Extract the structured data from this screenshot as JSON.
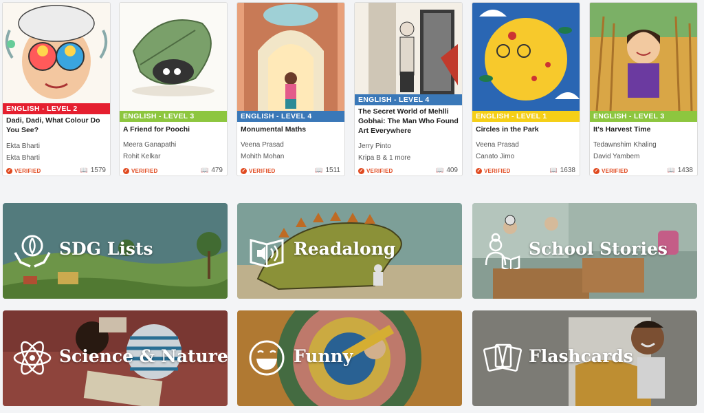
{
  "books": [
    {
      "level": "ENGLISH - LEVEL 2",
      "level_color": "#e51f2f",
      "title": "Dadi, Dadi, What Colour Do You See?",
      "authors": [
        "Ekta Bharti",
        "Ekta Bharti"
      ],
      "verified": "VERIFIED",
      "reads": "1579"
    },
    {
      "level": "ENGLISH - LEVEL 3",
      "level_color": "#8dc63f",
      "title": "A Friend for Poochi",
      "authors": [
        "Meera Ganapathi",
        "Rohit Kelkar"
      ],
      "verified": "VERIFIED",
      "reads": "479"
    },
    {
      "level": "ENGLISH - LEVEL 4",
      "level_color": "#3a78b8",
      "title": "Monumental Maths",
      "authors": [
        "Veena Prasad",
        "Mohith Mohan"
      ],
      "verified": "VERIFIED",
      "reads": "1511"
    },
    {
      "level": "ENGLISH - LEVEL 4",
      "level_color": "#3a78b8",
      "title": "The Secret World of Mehlli Gobhai: The Man Who Found Art Everywhere",
      "authors": [
        "Jerry Pinto",
        "Kripa B & 1 more"
      ],
      "verified": "VERIFIED",
      "reads": "409"
    },
    {
      "level": "ENGLISH - LEVEL 1",
      "level_color": "#f5cf17",
      "title": "Circles in the Park",
      "authors": [
        "Veena Prasad",
        "Canato Jimo"
      ],
      "verified": "VERIFIED",
      "reads": "1638"
    },
    {
      "level": "ENGLISH - LEVEL 3",
      "level_color": "#8dc63f",
      "title": "It's Harvest Time",
      "authors": [
        "Tedawnshim Khaling",
        "David Yambem"
      ],
      "verified": "VERIFIED",
      "reads": "1438"
    }
  ],
  "categories": [
    {
      "label": "SDG Lists",
      "icon": "hands-globe-icon"
    },
    {
      "label": "Readalong",
      "icon": "book-speaker-icon"
    },
    {
      "label": "School Stories",
      "icon": "teacher-icon"
    },
    {
      "label": "Science & Nature",
      "icon": "atom-icon"
    },
    {
      "label": "Funny",
      "icon": "laughing-face-icon"
    },
    {
      "label": "Flashcards",
      "icon": "cards-icon"
    }
  ]
}
